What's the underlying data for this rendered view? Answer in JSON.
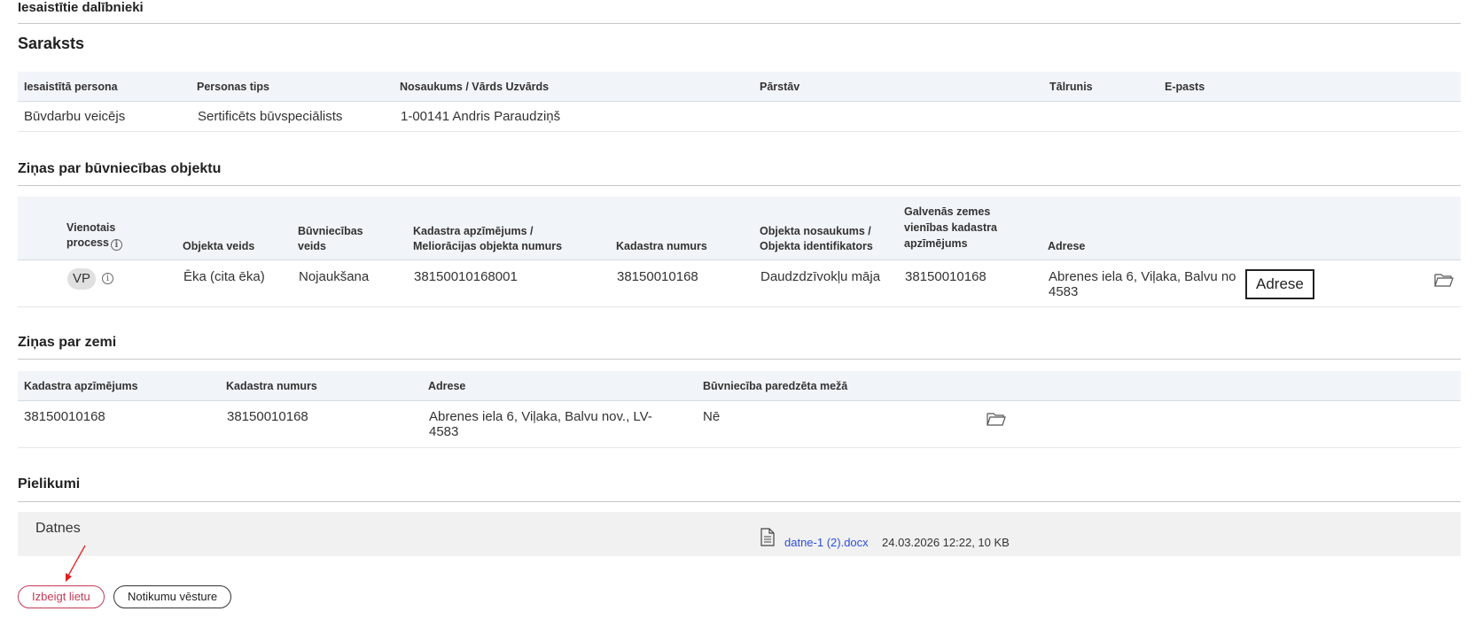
{
  "page_title": "Iesaistītie dalībnieki",
  "list_section": {
    "title": "Saraksts",
    "headers": [
      "Iesaistītā persona",
      "Personas tips",
      "Nosaukums / Vārds Uzvārds",
      "Pārstāv",
      "Tālrunis",
      "E-pasts"
    ],
    "rows": [
      [
        "Būvdarbu veicējs",
        "Sertificēts būvspeciālists",
        "1-00141 Andris Paraudziņš",
        "",
        "",
        ""
      ]
    ]
  },
  "object_section": {
    "title": "Ziņas par būvniecības objektu",
    "headers": {
      "vienotais_line1": "Vienotais",
      "vienotais_line2": "process",
      "objekta_veids": "Objekta veids",
      "buvn_veids_line1": "Būvniecības",
      "buvn_veids_line2": "veids",
      "kadastra_apz_line1": "Kadastra apzīmējums /",
      "kadastra_apz_line2": "Meliorācijas objekta numurs",
      "kadastra_numurs": "Kadastra numurs",
      "obj_nos_line1": "Objekta nosaukums /",
      "obj_nos_line2": "Objekta identifikators",
      "galv_line1": "Galvenās zemes",
      "galv_line2": "vienības kadastra",
      "galv_line3": "apzīmējums",
      "adrese": "Adrese"
    },
    "row": {
      "process": "VP",
      "objekta_veids": "Ēka (cita ēka)",
      "buvn_veids": "Nojaukšana",
      "kadastra_apz": "38150010168001",
      "kadastra_numurs": "38150010168",
      "obj_nos": "Daudzdzīvokļu māja",
      "galv": "38150010168",
      "adrese_line1": "Abrenes iela 6, Viļaka, Balvu no",
      "adrese_line2": "4583"
    },
    "tooltip": "Adrese"
  },
  "land_section": {
    "title": "Ziņas par zemi",
    "headers": [
      "Kadastra apzīmējums",
      "Kadastra numurs",
      "Adrese",
      "Būvniecība paredzēta mežā"
    ],
    "row": {
      "kadastra_apz": "38150010168",
      "kadastra_numurs": "38150010168",
      "adrese_line1": "Abrenes iela 6, Viļaka, Balvu nov., LV-",
      "adrese_line2": "4583",
      "mezs": "Nē"
    }
  },
  "attachments_section": {
    "title": "Pielikumi",
    "label": "Datnes",
    "file_name": "datne-1 (2).docx",
    "file_meta": "24.03.2026 12:22, 10 KB"
  },
  "buttons": {
    "end_case": "Izbeigt lietu",
    "history": "Notikumu vēsture"
  },
  "colors": {
    "accent_red": "#c33b57",
    "link_blue": "#2d4fd6",
    "header_bg": "#f1f4f8"
  }
}
